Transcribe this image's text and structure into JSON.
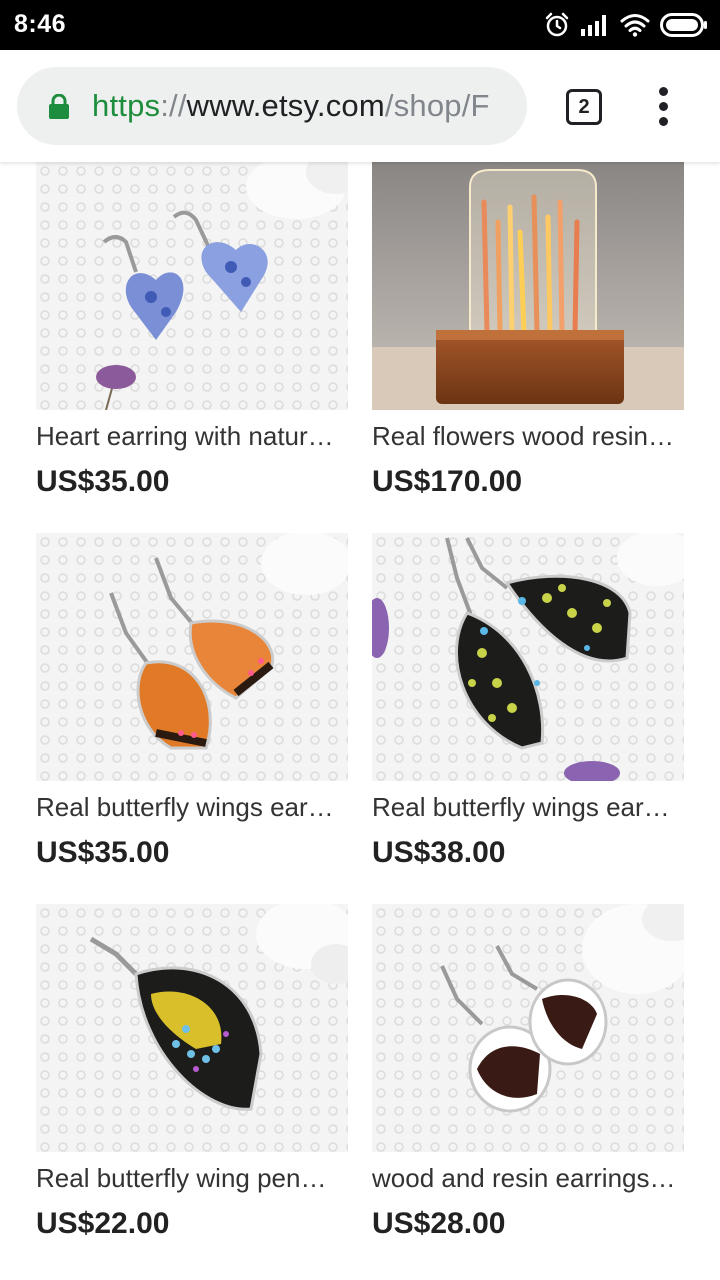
{
  "status_bar": {
    "time": "8:46",
    "icons": [
      "alarm-icon",
      "signal-icon",
      "wifi-icon",
      "battery-icon"
    ]
  },
  "browser": {
    "url": {
      "scheme": "https",
      "separator": "://",
      "host": "www.etsy.com",
      "path": "/shop/F"
    },
    "tab_count": "2",
    "colors": {
      "secure": "#1e8e3e",
      "pill": "#eef0ef"
    }
  },
  "listings": [
    {
      "title": "Heart earring with natur…",
      "price": "US$35.00",
      "image": "blue-heart-earrings"
    },
    {
      "title": "Real flowers wood resin…",
      "price": "US$170.00",
      "image": "resin-lamp-with-grass"
    },
    {
      "title": "Real butterfly wings ear…",
      "price": "US$35.00",
      "image": "orange-butterfly-wing-earrings"
    },
    {
      "title": "Real butterfly wings ear…",
      "price": "US$38.00",
      "image": "black-yellow-spotted-wing-earrings"
    },
    {
      "title": "Real butterfly wing pen…",
      "price": "US$22.00",
      "image": "yellow-butterfly-wing-pendant"
    },
    {
      "title": "wood and resin earrings…",
      "price": "US$28.00",
      "image": "oval-wood-resin-earrings"
    }
  ]
}
